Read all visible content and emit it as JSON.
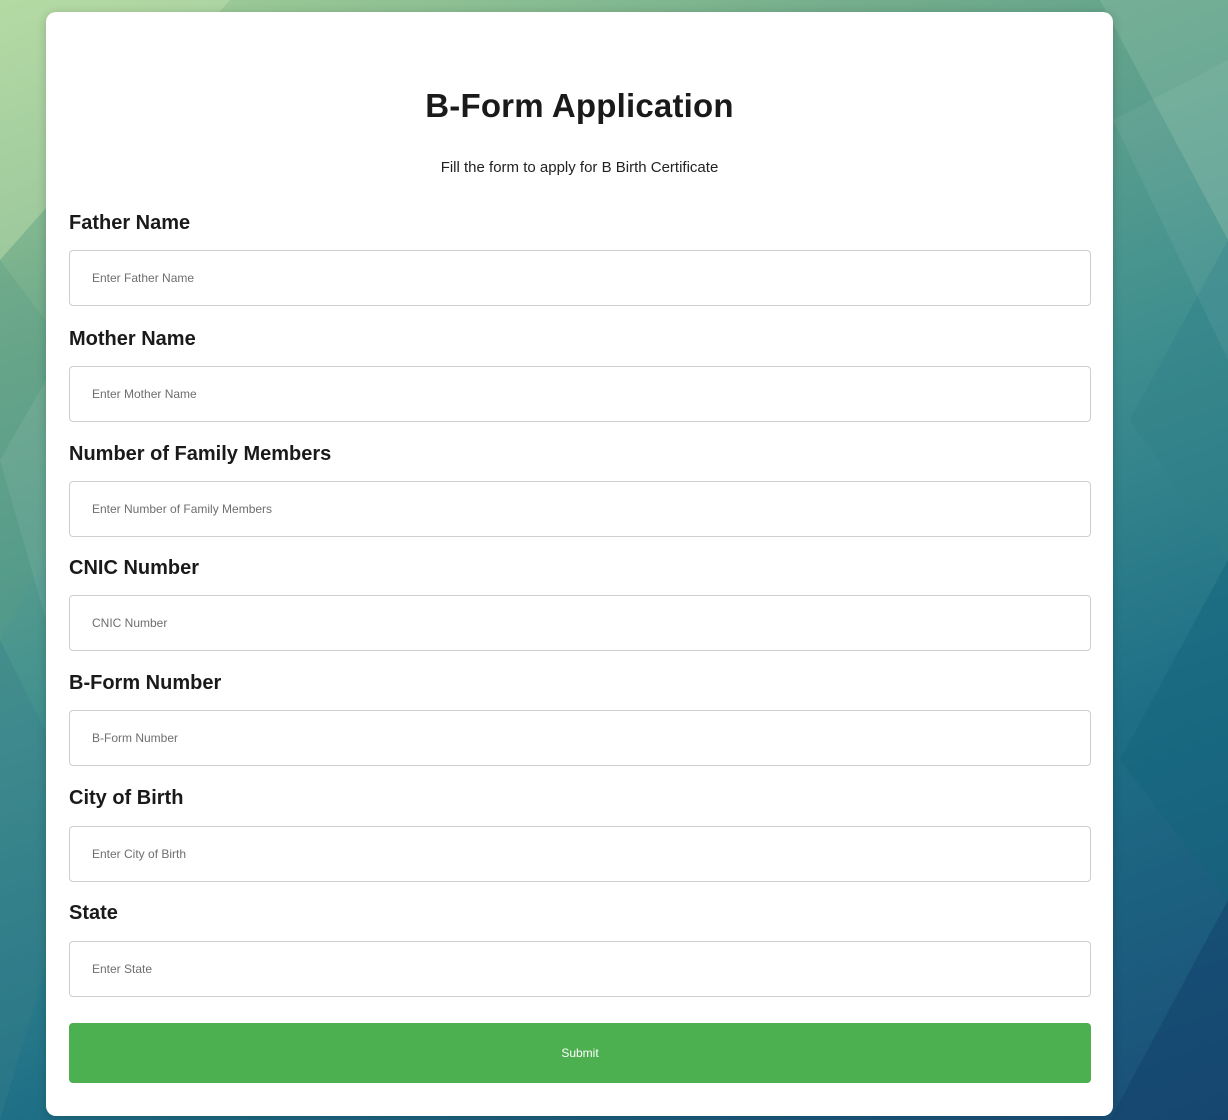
{
  "form": {
    "title": "B-Form Application",
    "subtitle": "Fill the form to apply for B Birth Certificate",
    "fields": [
      {
        "label": "Father Name",
        "placeholder": "Enter Father Name",
        "value": ""
      },
      {
        "label": "Mother Name",
        "placeholder": "Enter Mother Name",
        "value": ""
      },
      {
        "label": "Number of Family Members",
        "placeholder": "Enter Number of Family Members",
        "value": ""
      },
      {
        "label": "CNIC Number",
        "placeholder": "CNIC Number",
        "value": ""
      },
      {
        "label": "B-Form Number",
        "placeholder": "B-Form Number",
        "value": ""
      },
      {
        "label": "City of Birth",
        "placeholder": "Enter City of Birth",
        "value": ""
      },
      {
        "label": "State",
        "placeholder": "Enter State",
        "value": ""
      }
    ],
    "submit_label": "Submit"
  },
  "colors": {
    "card_background": "#ffffff",
    "submit_button": "#4caf50",
    "page_gradient": [
      "#a9d39a",
      "#3f8f8f",
      "#1a4d77"
    ]
  }
}
